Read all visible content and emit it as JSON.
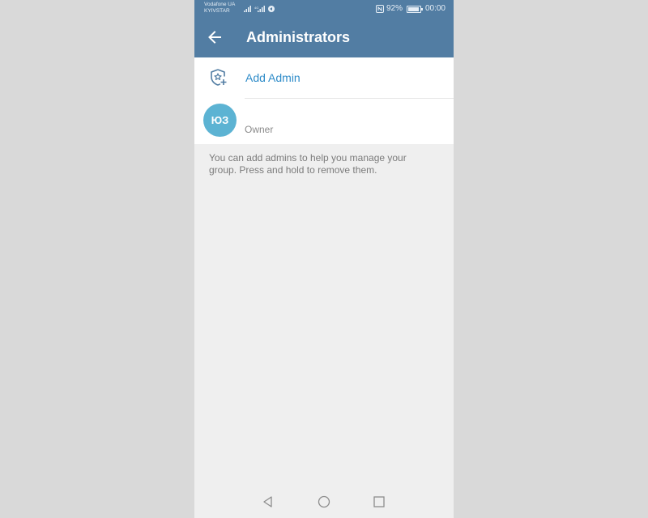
{
  "status_bar": {
    "carrier_line1": "Vodafone UA",
    "carrier_line2": "KYIVSTAR",
    "battery": "92%",
    "time": "00:00",
    "icons": [
      "signal-icon",
      "signal-4g-icon",
      "vpn-icon",
      "nfc-icon",
      "battery-icon"
    ]
  },
  "header": {
    "title": "Administrators",
    "back_icon": "arrow-left-icon"
  },
  "add_admin": {
    "label": "Add Admin",
    "icon": "shield-star-add-icon"
  },
  "owner": {
    "avatar_initials": "ЮЗ",
    "role": "Owner"
  },
  "info_text": "You can add admins to help you manage your group. Press and hold to remove them.",
  "nav": {
    "icons": [
      "back-triangle-icon",
      "home-circle-icon",
      "recents-square-icon"
    ]
  },
  "colors": {
    "header": "#527da3",
    "accent": "#2f8cc9",
    "avatar": "#5cb3d3",
    "background": "#efefef"
  }
}
